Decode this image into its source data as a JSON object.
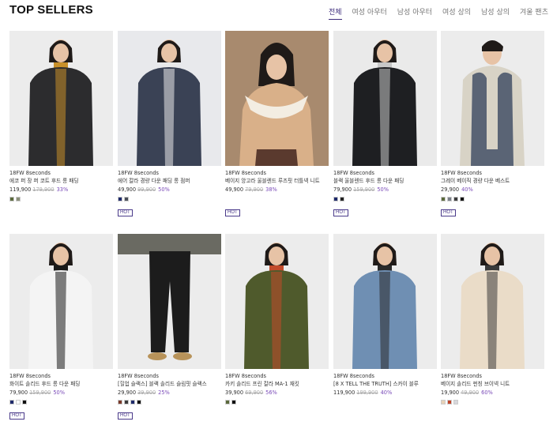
{
  "header": {
    "title": "TOP SELLERS",
    "tabs": [
      {
        "label": "전체",
        "active": true
      },
      {
        "label": "여성 아우터",
        "active": false
      },
      {
        "label": "남성 아우터",
        "active": false
      },
      {
        "label": "여성 상의",
        "active": false
      },
      {
        "label": "남성 상의",
        "active": false
      },
      {
        "label": "겨울 팬츠",
        "active": false
      }
    ]
  },
  "products": [
    {
      "brand": "18FW 8seconds",
      "name": "에코 퍼 장 퍼 코트 후드 롱 패딩",
      "price": "119,900",
      "original": "179,900",
      "discount": "33%",
      "swatches": [
        "#5b6a3c",
        "#8a8f7a"
      ],
      "hot": "",
      "bg": "#ececec",
      "garment": "#2c2c2e",
      "accent": "#c8902a"
    },
    {
      "brand": "18FW 8seconds",
      "name": "에어 칼라 경량 다운 패딩 롱 점퍼",
      "price": "49,900",
      "original": "99,900",
      "discount": "50%",
      "swatches": [
        "#1e2a6b",
        "#4a4f5a"
      ],
      "hot": "HOT",
      "bg": "#e8e9ec",
      "garment": "#3a4255",
      "accent": "#e9e9ea"
    },
    {
      "brand": "18FW 8seconds",
      "name": "베이지 앙고라 울블렌드 루즈핏 터틀넥 니트",
      "price": "49,900",
      "original": "79,900",
      "discount": "38%",
      "swatches": [],
      "hot": "HOT",
      "bg": "#a88a6e",
      "garment": "#d9b089",
      "accent": "#f3ede2"
    },
    {
      "brand": "18FW 8seconds",
      "name": "블랙 울블렌드 후드 롱 다운 패딩",
      "price": "79,900",
      "original": "159,900",
      "discount": "50%",
      "swatches": [
        "#1e2a6b",
        "#222222"
      ],
      "hot": "HOT",
      "bg": "#eaeaea",
      "garment": "#1e1f22",
      "accent": "#c7c7c7"
    },
    {
      "brand": "18FW 8seconds",
      "name": "그레이 베이직 경량 다운 베스트",
      "price": "29,900",
      "original": "",
      "discount": "40%",
      "swatches": [
        "#5b6a3c",
        "#7a7f88",
        "#3c3c3c",
        "#111111"
      ],
      "hot": "HOT",
      "bg": "#ececec",
      "garment": "#5a6475",
      "accent": "#d8d3c6"
    },
    {
      "brand": "18FW 8seconds",
      "name": "화이트 솔리드 후드 롱 다운 패딩",
      "price": "79,900",
      "original": "159,900",
      "discount": "50%",
      "swatches": [
        "#1e2a6b",
        "#ffffff",
        "#111111"
      ],
      "hot": "HOT",
      "bg": "#ececec",
      "garment": "#f4f4f4",
      "accent": "#1a1a1a"
    },
    {
      "brand": "18FW 8seconds",
      "name": "[힐업 슬랙스] 블랙 솔리드 슬림핏 슬랙스",
      "price": "29,900",
      "original": "39,900",
      "discount": "25%",
      "swatches": [
        "#7a3a2a",
        "#3c3c3c",
        "#1e2a6b",
        "#111111"
      ],
      "hot": "HOT",
      "bg": "#ececec",
      "garment": "#1c1c1c",
      "accent": "#b8935a"
    },
    {
      "brand": "18FW 8seconds",
      "name": "카키 솔리드 프린 칼라 MA-1 재킷",
      "price": "39,900",
      "original": "69,900",
      "discount": "56%",
      "swatches": [
        "#5b6a3c",
        "#111111"
      ],
      "hot": "",
      "bg": "#ececec",
      "garment": "#4f5a2c",
      "accent": "#c24a2a"
    },
    {
      "brand": "18FW 8seconds",
      "name": "[8 X TELL THE TRUTH] 스카이 블루",
      "price": "119,900",
      "original": "199,900",
      "discount": "40%",
      "swatches": [],
      "hot": "",
      "bg": "#ececec",
      "garment": "#6f8fb3",
      "accent": "#2a2a2a"
    },
    {
      "brand": "18FW 8seconds",
      "name": "베이지 솔리드 펀칭 브이넥 니트",
      "price": "19,900",
      "original": "49,900",
      "discount": "60%",
      "swatches": [
        "#e8d3b8",
        "#c0442a",
        "#d8d8dc"
      ],
      "hot": "",
      "bg": "#ececec",
      "garment": "#eadcc8",
      "accent": "#3a3a3a"
    }
  ]
}
